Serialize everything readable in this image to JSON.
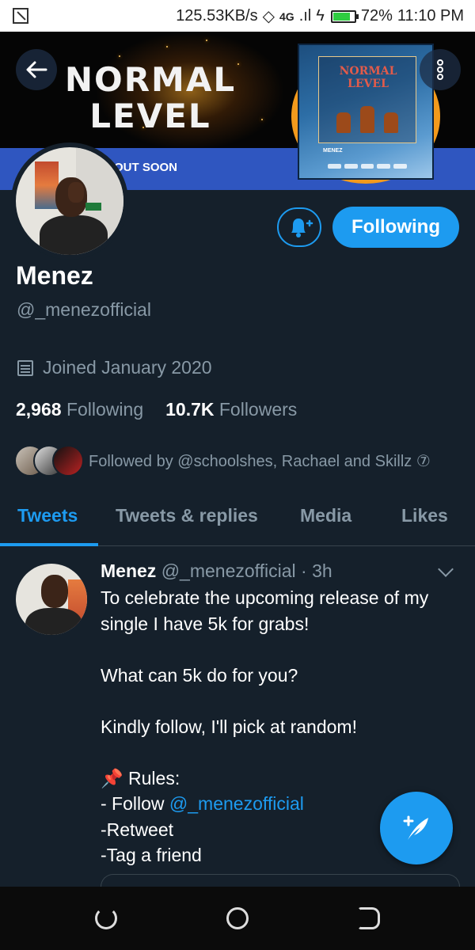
{
  "status_bar": {
    "speed": "125.53KB/s",
    "network": "4G",
    "battery": "72%",
    "time": "11:10 PM"
  },
  "banner": {
    "title_line1": "NORMAL",
    "title_line2": "LEVEL",
    "strip_text": "OUT SOON",
    "album_title": "NORMAL LEVEL",
    "album_artist": "MENEZ"
  },
  "profile": {
    "name": "Menez",
    "handle": "@_menezofficial",
    "joined": "Joined January 2020",
    "following_count": "2,968",
    "following_label": "Following",
    "followers_count": "10.7K",
    "followers_label": "Followers",
    "followed_by": "Followed by @schoolshes, Rachael and Skillz ⑦",
    "follow_button": "Following"
  },
  "tabs": [
    {
      "label": "Tweets",
      "active": true
    },
    {
      "label": "Tweets & replies",
      "active": false
    },
    {
      "label": "Media",
      "active": false
    },
    {
      "label": "Likes",
      "active": false
    }
  ],
  "tweet": {
    "name": "Menez",
    "meta": "@_menezofficial · 3h",
    "line1": "To celebrate the upcoming release of my",
    "line2": "single I have 5k for grabs!",
    "line3": "What can 5k do for you?",
    "line4": "Kindly follow, I'll pick at random!",
    "rules_label": " Rules:",
    "rule1_prefix": "- Follow ",
    "rule1_mention": "@_menezofficial",
    "rule2": "-Retweet",
    "rule3": "-Tag a friend"
  },
  "colors": {
    "background": "#15202b",
    "accent": "#1d9bf0",
    "muted": "#8899a6"
  }
}
